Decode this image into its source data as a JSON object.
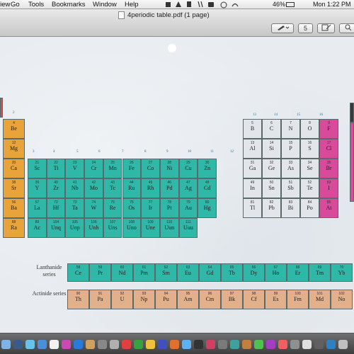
{
  "menubar": {
    "items": [
      "View",
      "Go",
      "Tools",
      "Bookmarks",
      "Window",
      "Help"
    ],
    "battery": "46%",
    "clock": "Mon 1:22 PM"
  },
  "window": {
    "title": "4periodic table.pdf (1 page)",
    "page_button": "5"
  },
  "periodic_table": {
    "group_numbers": [
      "2",
      "3",
      "4",
      "5",
      "6",
      "7",
      "8",
      "9",
      "10",
      "11",
      "12",
      "13",
      "14",
      "15",
      "16"
    ],
    "rows": [
      [
        "Be",
        "B",
        "C",
        "N",
        "O",
        "F"
      ],
      [
        "Mg",
        "Al",
        "Si",
        "P",
        "S",
        "Cl"
      ],
      [
        "Ca",
        "Sc",
        "Ti",
        "V",
        "Cr",
        "Mn",
        "Fe",
        "Co",
        "Ni",
        "Cu",
        "Zn",
        "Ga",
        "Ge",
        "As",
        "Se",
        "Br"
      ],
      [
        "Sr",
        "Y",
        "Zr",
        "Nb",
        "Mo",
        "Tc",
        "Ru",
        "Rh",
        "Pd",
        "Ag",
        "Cd",
        "In",
        "Sn",
        "Sb",
        "Te",
        "I"
      ],
      [
        "Ba",
        "La",
        "Hf",
        "Ta",
        "W",
        "Re",
        "Os",
        "Ir",
        "Pt",
        "Au",
        "Hg",
        "Tl",
        "Pb",
        "Bi",
        "Po",
        "At"
      ],
      [
        "Ra",
        "Ac",
        "Unq",
        "Unp",
        "Unh",
        "Uns",
        "Uno",
        "Une",
        "Uun",
        "Uuu"
      ]
    ],
    "numbers": [
      [
        "4",
        "5",
        "6",
        "7",
        "8",
        "9"
      ],
      [
        "12",
        "13",
        "14",
        "15",
        "16",
        "17"
      ],
      [
        "20",
        "21",
        "22",
        "23",
        "24",
        "25",
        "26",
        "27",
        "28",
        "29",
        "30",
        "31",
        "32",
        "33",
        "34",
        "35"
      ],
      [
        "38",
        "39",
        "40",
        "41",
        "42",
        "43",
        "44",
        "45",
        "46",
        "47",
        "48",
        "49",
        "50",
        "51",
        "52",
        "53"
      ],
      [
        "56",
        "57",
        "72",
        "73",
        "74",
        "75",
        "76",
        "77",
        "78",
        "79",
        "80",
        "81",
        "82",
        "83",
        "84",
        "85"
      ],
      [
        "88",
        "89",
        "104",
        "105",
        "106",
        "107",
        "108",
        "109",
        "110",
        "111"
      ]
    ],
    "lanthanide_label": "Lanthanide series",
    "lanthanides": [
      "Ce",
      "Pr",
      "Nd",
      "Pm",
      "Sm",
      "Eu",
      "Gd",
      "Tb",
      "Dy",
      "Ho",
      "Er",
      "Tm",
      "Yb"
    ],
    "lanthanide_numbers": [
      "58",
      "59",
      "60",
      "61",
      "62",
      "63",
      "64",
      "65",
      "66",
      "67",
      "68",
      "69",
      "70"
    ],
    "actinide_label": "Actinide series",
    "actinides": [
      "Th",
      "Pa",
      "U",
      "Np",
      "Pu",
      "Am",
      "Cm",
      "Bk",
      "Cf",
      "Es",
      "Fm",
      "Md",
      "No"
    ],
    "actinide_numbers": [
      "90",
      "91",
      "92",
      "93",
      "94",
      "95",
      "96",
      "97",
      "98",
      "99",
      "100",
      "101",
      "102"
    ]
  },
  "colors": {
    "alkaline_earth": "#e8a33a",
    "transition": "#2fb8a8",
    "p_block": "#e2e6ea",
    "halogen": "#d84a9a",
    "actinide": "#e2b08a"
  },
  "dock_icons": [
    "finder-icon",
    "dashboard-icon",
    "mail-icon",
    "safari-icon",
    "ical-icon",
    "itunes-icon",
    "iphoto-icon",
    "preview-icon",
    "system-prefs-icon",
    "trash-icon"
  ]
}
